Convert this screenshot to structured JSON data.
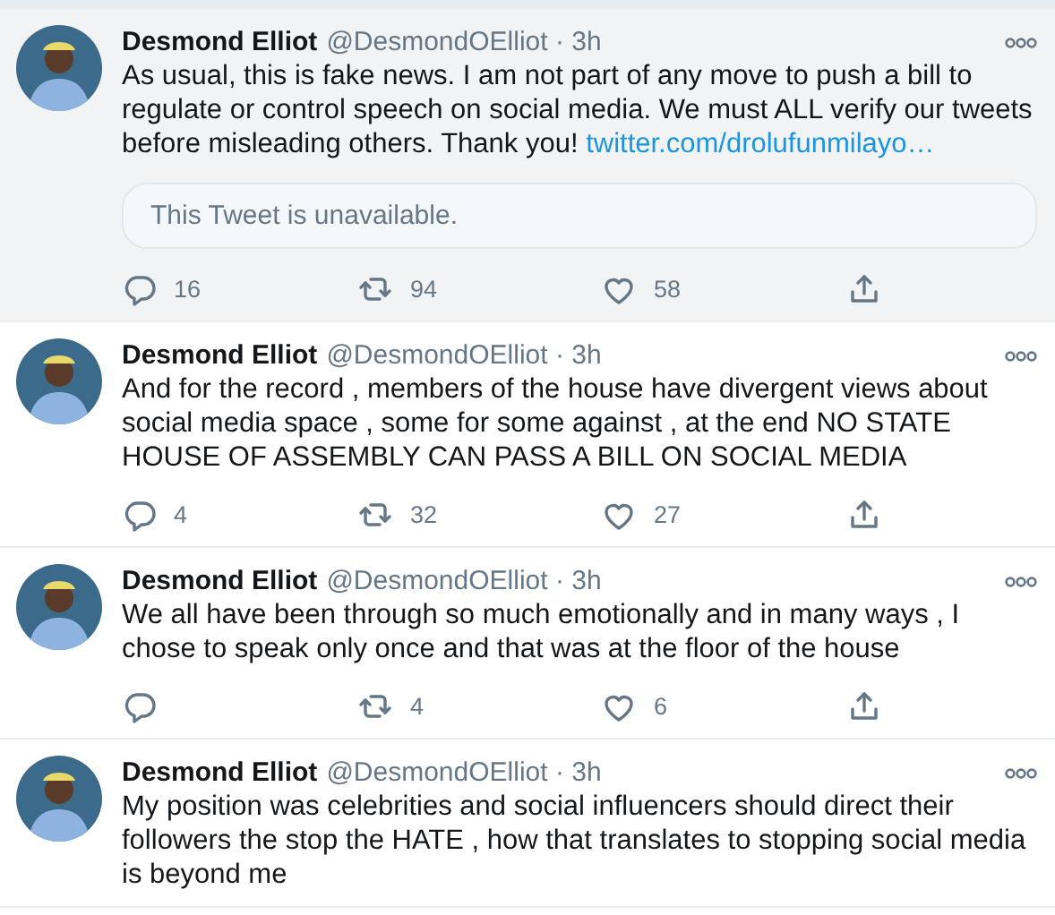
{
  "tweets": [
    {
      "name": "Desmond Elliot",
      "handle": "@DesmondOElliot",
      "separator": "·",
      "time": "3h",
      "highlighted": true,
      "text": "As usual, this is fake news. I am not part of any move to push a bill to regulate or control speech on social media. We must ALL verify our tweets before misleading others. Thank you!",
      "link": "twitter.com/drolufunmilayo…",
      "quote": "This Tweet is unavailable.",
      "replies": "16",
      "retweets": "94",
      "likes": "58"
    },
    {
      "name": "Desmond Elliot",
      "handle": "@DesmondOElliot",
      "separator": "·",
      "time": "3h",
      "highlighted": false,
      "text": "And for the record , members of the house have divergent views about social media space , some for some against , at the end NO STATE HOUSE OF ASSEMBLY CAN PASS A BILL ON SOCIAL MEDIA",
      "replies": "4",
      "retweets": "32",
      "likes": "27"
    },
    {
      "name": "Desmond Elliot",
      "handle": "@DesmondOElliot",
      "separator": "·",
      "time": "3h",
      "highlighted": false,
      "text": "We all have been through so much emotionally and in many ways , I chose to speak only once and that was at the floor of the house",
      "retweets": "4",
      "likes": "6"
    },
    {
      "name": "Desmond Elliot",
      "handle": "@DesmondOElliot",
      "separator": "·",
      "time": "3h",
      "highlighted": false,
      "text": "My position was celebrities and social influencers should direct their followers the stop the HATE ,  how that translates to stopping social media is beyond me"
    }
  ]
}
